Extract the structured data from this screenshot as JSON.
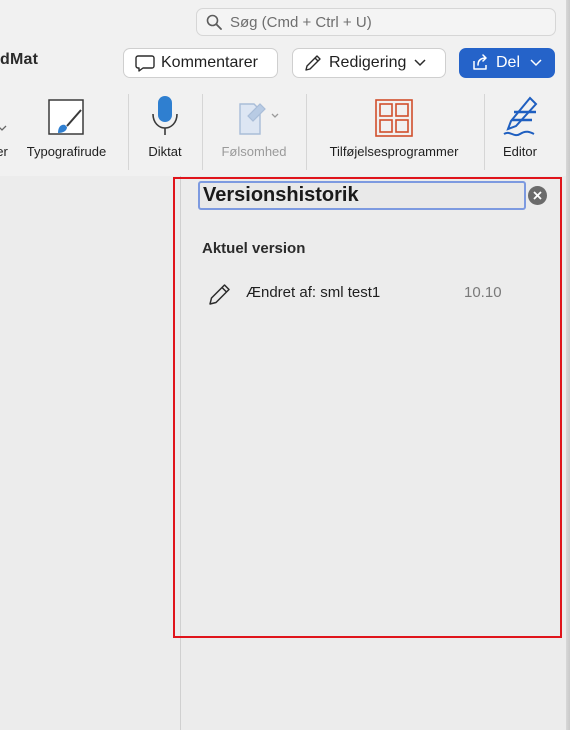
{
  "titlebar": {
    "search_placeholder": "Søg (Cmd + Ctrl + U)",
    "doc_title": "dMat",
    "comments_label": "Kommentarer",
    "editing_label": "Redigering",
    "share_label": "Del"
  },
  "ribbon": {
    "items": [
      {
        "label": "er"
      },
      {
        "label": "Typografirude"
      },
      {
        "label": "Diktat"
      },
      {
        "label": "Følsomhed"
      },
      {
        "label": "Tilføjelsesprogrammer"
      },
      {
        "label": "Editor"
      }
    ]
  },
  "pane": {
    "title": "Versionshistorik",
    "section_heading": "Aktuel version",
    "versions": [
      {
        "text": "Ændret af: sml test1",
        "time": "10.10"
      }
    ]
  },
  "colors": {
    "accent": "#2563c9",
    "highlight": "#e0141b",
    "title_focus": "#7d9ae0"
  }
}
